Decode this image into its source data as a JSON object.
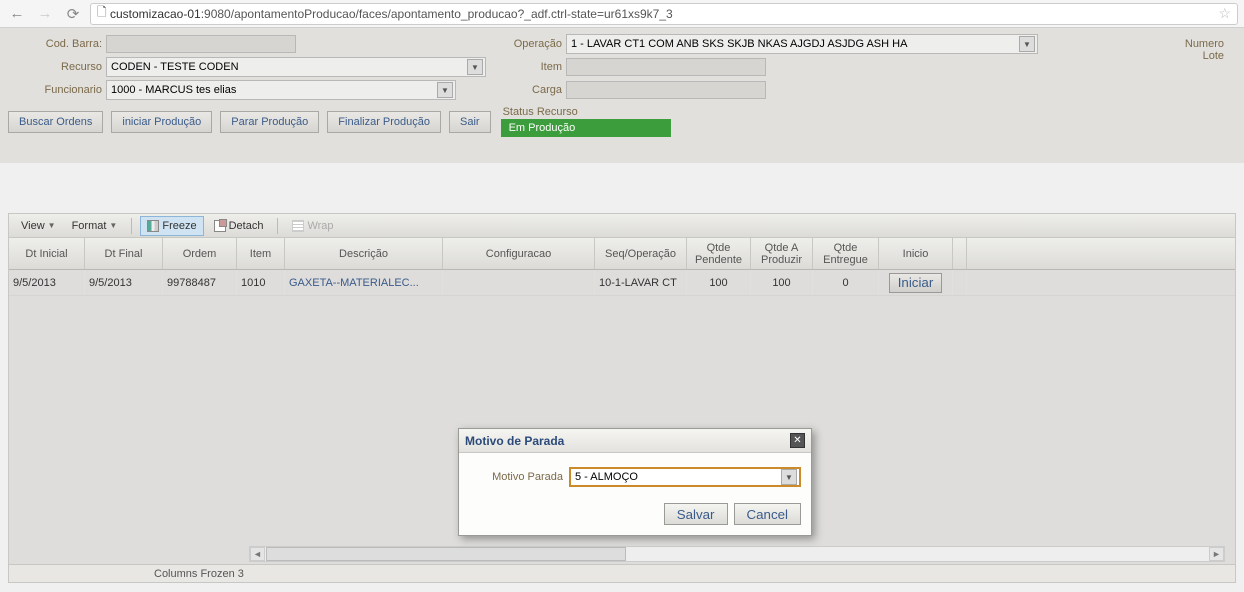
{
  "browser": {
    "url_host": "customizacao-01",
    "url_rest": ":9080/apontamentoProducao/faces/apontamento_producao?_adf.ctrl-state=ur61xs9k7_3"
  },
  "form": {
    "cod_barra_label": "Cod. Barra:",
    "cod_barra_value": "",
    "operacao_label": "Operação",
    "operacao_value": "1 - LAVAR CT1 COM ANB SKS SKJB NKAS AJGDJ ASJDG ASH HA",
    "recurso_label": "Recurso",
    "recurso_value": "CODEN - TESTE CODEN",
    "item_label": "Item",
    "item_value": "",
    "funcionario_label": "Funcionario",
    "funcionario_value": "1000 - MARCUS tes elias",
    "carga_label": "Carga",
    "carga_value": "",
    "status_label": "Status Recurso",
    "status_value": "Em Produção",
    "numero_label": "Numero",
    "lote_label": "Lote"
  },
  "buttons": {
    "buscar": "Buscar Ordens",
    "iniciar_prod": "iniciar Produção",
    "parar": "Parar Produção",
    "finalizar": "Finalizar Produção",
    "sair": "Sair"
  },
  "toolbar": {
    "view": "View",
    "format": "Format",
    "freeze": "Freeze",
    "detach": "Detach",
    "wrap": "Wrap"
  },
  "table": {
    "headers": {
      "dt_inicial": "Dt Inicial",
      "dt_final": "Dt Final",
      "ordem": "Ordem",
      "item": "Item",
      "descricao": "Descrição",
      "configuracao": "Configuracao",
      "seq_op": "Seq/Operação",
      "qtde_pend": "Qtde Pendente",
      "qtde_prod": "Qtde A Produzir",
      "qtde_ent": "Qtde Entregue",
      "inicio": "Inicio"
    },
    "rows": [
      {
        "dt_inicial": "9/5/2013",
        "dt_final": "9/5/2013",
        "ordem": "99788487",
        "item": "1010",
        "descricao": "GAXETA--MATERIALEC...",
        "configuracao": "",
        "seq_op": "10-1-LAVAR CT",
        "qtde_pend": "100",
        "qtde_prod": "100",
        "qtde_ent": "0",
        "inicio_btn": "Iniciar"
      }
    ]
  },
  "footer": {
    "frozen": "Columns Frozen 3"
  },
  "dialog": {
    "title": "Motivo de Parada",
    "label": "Motivo Parada",
    "value": "5 - ALMOÇO",
    "save": "Salvar",
    "cancel": "Cancel"
  }
}
